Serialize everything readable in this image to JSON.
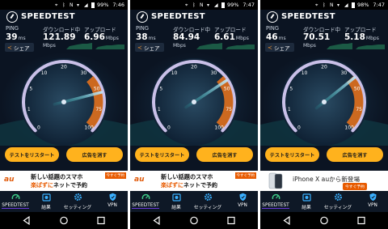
{
  "tests": [
    {
      "status": {
        "battery": "99%",
        "time": "7:46"
      },
      "app_title": "SPEEDTEST",
      "ping": {
        "label": "PING",
        "value": "39",
        "unit": "ms"
      },
      "download": {
        "label": "ダウンロード中",
        "value": "121.89",
        "unit": "Mbps"
      },
      "upload": {
        "label": "アップロード",
        "value": "6.96",
        "unit": "Mbps"
      },
      "share_label": "シェア",
      "gauge_ticks": [
        "0",
        "1",
        "5",
        "10",
        "20",
        "30",
        "50",
        "75",
        "100"
      ],
      "restart_label": "テストをリスタート",
      "ad_button_label": "広告を消す",
      "ad": {
        "type": "au",
        "logo": "au",
        "line1": "新しい話題のスマホ",
        "line2_highlight": "楽ぱずに",
        "line2_rest": "ネットで予約",
        "tag": "今すぐ予約"
      },
      "tabs": {
        "speedtest": "SPEEDTEST",
        "results": "結果",
        "settings": "セッティング",
        "vpn": "VPN"
      }
    },
    {
      "status": {
        "battery": "99%",
        "time": "7:47"
      },
      "app_title": "SPEEDTEST",
      "ping": {
        "label": "PING",
        "value": "38",
        "unit": "ms"
      },
      "download": {
        "label": "ダウンロード中",
        "value": "84.94",
        "unit": "Mbps"
      },
      "upload": {
        "label": "アップロード",
        "value": "6.61",
        "unit": "Mbps"
      },
      "share_label": "シェア",
      "gauge_ticks": [
        "0",
        "1",
        "5",
        "10",
        "20",
        "30",
        "50",
        "75",
        "100"
      ],
      "restart_label": "テストをリスタート",
      "ad_button_label": "広告を消す",
      "ad": {
        "type": "au",
        "logo": "au",
        "line1": "新しい話題のスマホ",
        "line2_highlight": "楽ぱずに",
        "line2_rest": "ネットで予約",
        "tag": "今すぐ予約"
      },
      "tabs": {
        "speedtest": "SPEEDTEST",
        "results": "結果",
        "settings": "セッティング",
        "vpn": "VPN"
      }
    },
    {
      "status": {
        "battery": "98%",
        "time": "7:47"
      },
      "app_title": "SPEEDTEST",
      "ping": {
        "label": "PING",
        "value": "46",
        "unit": "ms"
      },
      "download": {
        "label": "ダウンロード中",
        "value": "70.51",
        "unit": "Mbps"
      },
      "upload": {
        "label": "アップロード",
        "value": "5.18",
        "unit": "Mbps"
      },
      "share_label": "シェア",
      "gauge_ticks": [
        "0",
        "1",
        "5",
        "10",
        "20",
        "30",
        "50",
        "75",
        "100"
      ],
      "restart_label": "テストをリスタート",
      "ad_button_label": "広告を消す",
      "ad": {
        "type": "iphone",
        "logo": "",
        "line1": "iPhone X auから新登場",
        "tag": "今すぐ予約"
      },
      "tabs": {
        "speedtest": "SPEEDTEST",
        "results": "結果",
        "settings": "セッティング",
        "vpn": "VPN"
      }
    }
  ],
  "colors": {
    "background": "#0b1422",
    "accent_orange": "#ffb21d",
    "gauge_high": "#e0701d",
    "active_tab_underline": "#6b3bd8",
    "ad_orange": "#e85b00"
  }
}
